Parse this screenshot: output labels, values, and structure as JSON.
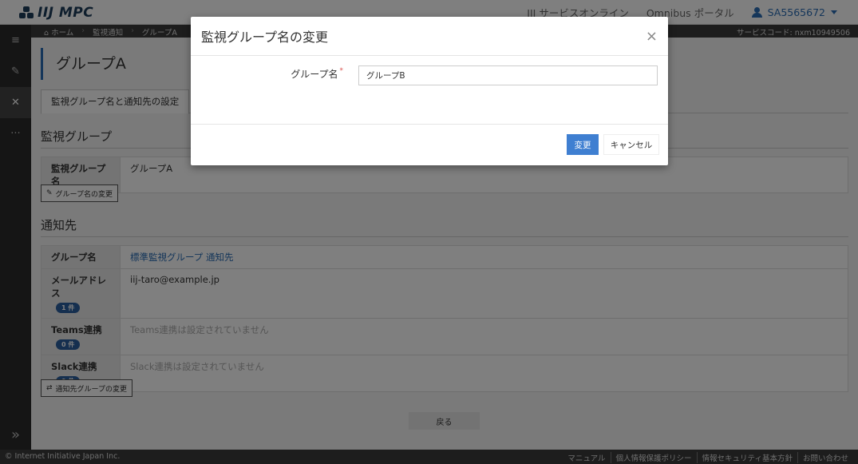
{
  "header": {
    "logo_text": "IIJ MPC",
    "nav": [
      "IIJ サービスオンライン",
      "Omnibus ポータル"
    ],
    "user_id": "SA5565672"
  },
  "sidebar": {
    "items": [
      {
        "icon": "list-icon",
        "glyph": "≡"
      },
      {
        "icon": "edit-icon",
        "glyph": "✎"
      },
      {
        "icon": "tools-icon",
        "glyph": "✕"
      },
      {
        "icon": "more-icon",
        "glyph": "···"
      }
    ],
    "expand_glyph": "»"
  },
  "breadcrumb": {
    "home": "ホーム",
    "items": [
      "監視通知",
      "グループA"
    ],
    "service_code": "サービスコード: nxm10949506"
  },
  "page": {
    "title": "グループA",
    "tab": "監視グループ名と通知先の設定"
  },
  "monitor_group": {
    "heading": "監視グループ",
    "label": "監視グループ名",
    "value": "グループA",
    "button": "グループ名の変更"
  },
  "notify": {
    "heading": "通知先",
    "rows": [
      {
        "label": "グループ名",
        "value": "標準監視グループ 通知先"
      },
      {
        "label": "メールアドレス",
        "badge": "1 件",
        "value": "iij-taro@example.jp"
      },
      {
        "label": "Teams連携",
        "badge": "0 件",
        "value": "Teams連携は設定されていません"
      },
      {
        "label": "Slack連携",
        "badge": "0 件",
        "value": "Slack連携は設定されていません"
      }
    ],
    "button": "通知先グループの変更"
  },
  "back_button": "戻る",
  "footer": {
    "copyright": "© Internet Initiative Japan Inc.",
    "links": [
      "マニュアル",
      "個人情報保護ポリシー",
      "情報セキュリティ基本方針",
      "お問い合わせ"
    ]
  },
  "modal": {
    "title": "監視グループ名の変更",
    "close": "×",
    "field_label": "グループ名",
    "required_mark": "*",
    "field_value": "グループB",
    "submit": "変更",
    "cancel": "キャンセル"
  },
  "colors": {
    "accent": "#2a6db5",
    "primary_button": "#3f7fd1",
    "sidebar": "#2b2b2b",
    "badge": "#2a5f9e"
  }
}
